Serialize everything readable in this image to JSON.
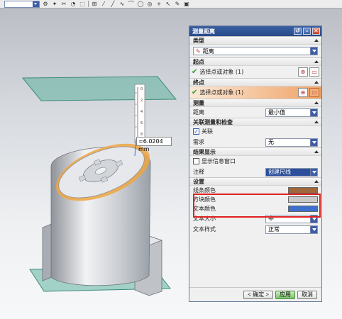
{
  "toolbar": {
    "icons": [
      "filter-dropdown",
      "gear-icon",
      "snap-icon",
      "scissors-icon",
      "view-icon",
      "select-box-icon",
      "grid-icon",
      "line-icon",
      "curve-icon",
      "arc-icon",
      "circle-icon",
      "circle-icon-2",
      "plus-icon",
      "cursor-icon",
      "pencil-icon",
      "cube-icon"
    ]
  },
  "viewport": {
    "measurement_label": "=6.0204 mm",
    "ruler_ticks": [
      "0",
      "2",
      "4",
      "6",
      "8"
    ]
  },
  "dialog": {
    "title": "测量距离",
    "type_section": {
      "heading": "类型",
      "value": "距离"
    },
    "start_section": {
      "heading": "起点",
      "pick_label": "选择点或对象 (1)"
    },
    "end_section": {
      "heading": "终点",
      "pick_label": "选择点或对象 (1)"
    },
    "measure_section": {
      "heading": "测量",
      "distance_label": "距离",
      "distance_value": "最小值"
    },
    "assoc_section": {
      "heading": "关联测量和检查",
      "assoc_checkbox_label": "关联",
      "requirement_label": "需求",
      "requirement_value": "无"
    },
    "results_section": {
      "heading": "结果显示",
      "show_info_label": "显示信息窗口",
      "annotation_label": "注释",
      "annotation_value": "创建尺线"
    },
    "settings_section": {
      "heading": "设置",
      "line_color_label": "线条颜色",
      "line_color": "#a0673a",
      "block_color_label": "方块颜色",
      "block_color": "#c9c9c9",
      "text_color_label": "文本颜色",
      "text_color": "#3d6fcf",
      "text_size_label": "文本大小",
      "text_size_value": "中",
      "text_style_label": "文本样式",
      "text_style_value": "正常"
    },
    "buttons": {
      "ok": "< 确定 >",
      "apply": "应用",
      "cancel": "取消"
    }
  }
}
